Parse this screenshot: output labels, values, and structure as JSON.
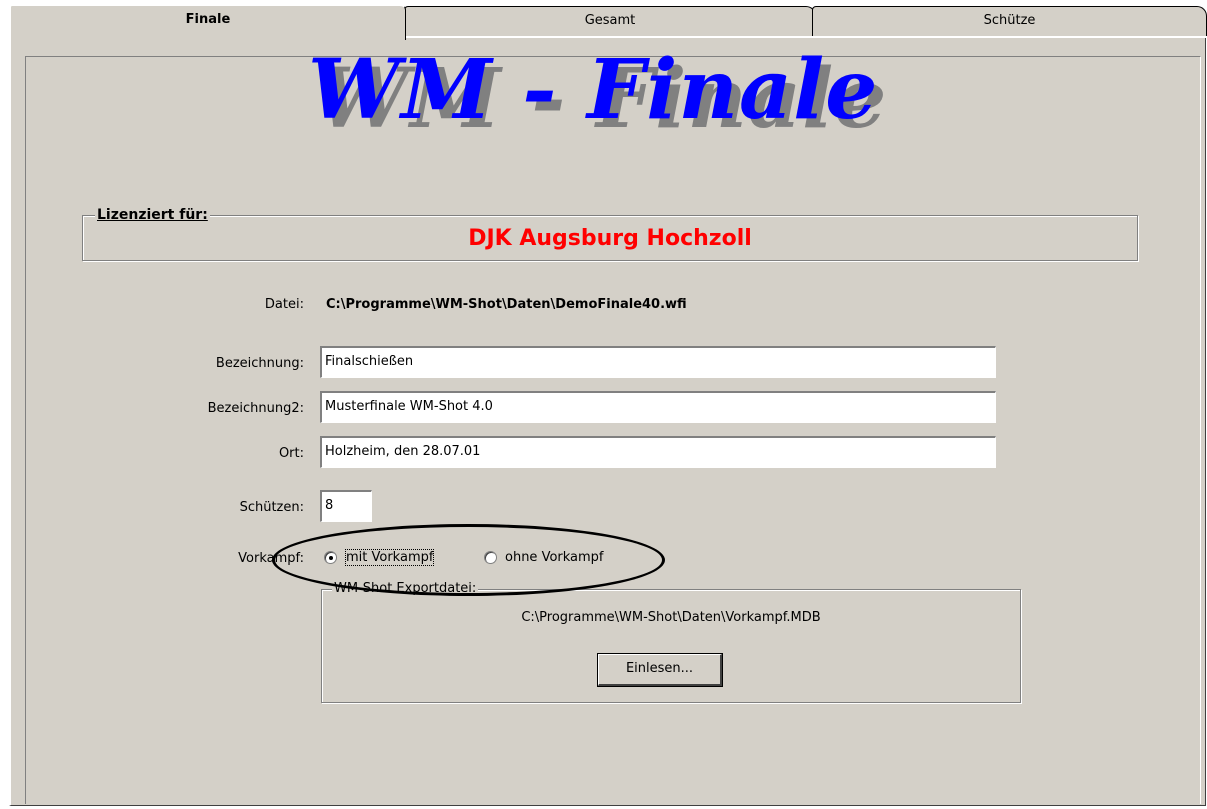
{
  "tabs": [
    {
      "label": "Finale",
      "active": true
    },
    {
      "label": "Gesamt",
      "active": false
    },
    {
      "label": "Schütze",
      "active": false
    }
  ],
  "title": "WM - Finale",
  "license": {
    "legend": "Lizenziert für:",
    "name": "DJK Augsburg Hochzoll"
  },
  "file": {
    "label": "Datei:",
    "value": "C:\\Programme\\WM-Shot\\Daten\\DemoFinale40.wfi"
  },
  "fields": {
    "bezeichnung": {
      "label": "Bezeichnung:",
      "value": "Finalschießen"
    },
    "bezeichnung2": {
      "label": "Bezeichnung2:",
      "value": "Musterfinale WM-Shot 4.0"
    },
    "ort": {
      "label": "Ort:",
      "value": "Holzheim, den 28.07.01"
    },
    "schuetzen": {
      "label": "Schützen:",
      "value": "8"
    }
  },
  "vorkampf": {
    "label": "Vorkampf:",
    "option_with": "mit Vorkampf",
    "option_without": "ohne Vorkampf",
    "selected": "mit Vorkampf"
  },
  "export": {
    "legend": "WM-Shot Exportdatei:",
    "path": "C:\\Programme\\WM-Shot\\Daten\\Vorkampf.MDB",
    "button_label": "Einlesen..."
  },
  "colors": {
    "title_blue": "#0000ff",
    "license_red": "#ff0000",
    "panel_gray": "#d4d0c8"
  }
}
